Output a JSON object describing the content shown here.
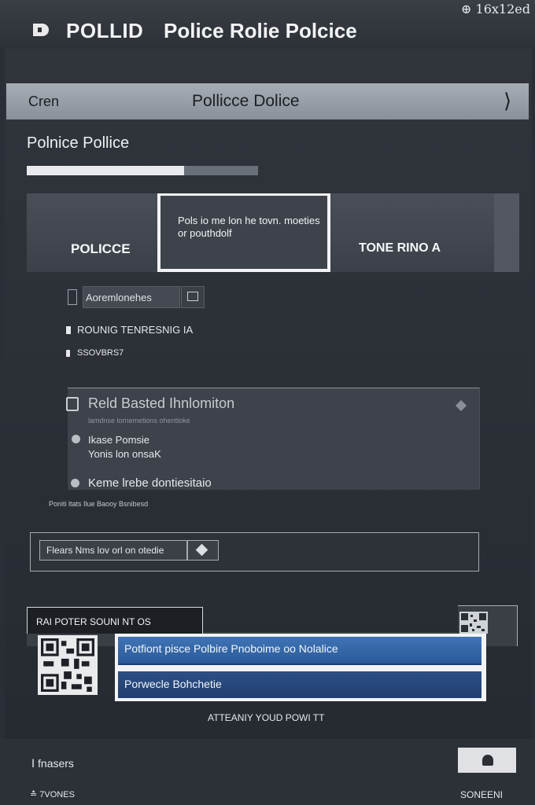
{
  "status_bar": {
    "text": "⊕ 16x12ed"
  },
  "header": {
    "brand": "POLLID",
    "title": "Police Rolie Polcice"
  },
  "navbar": {
    "left": "Cren",
    "center": "Pollicce Dolice",
    "chevron": "⟩"
  },
  "section": {
    "title": "Polnice Pollice",
    "progress": 0.68
  },
  "tabs": {
    "left_label": "POLICCE",
    "popup_text": "Pols io me lon he tovn. moeties or pouthdolf",
    "right_label": "TONE RINO A"
  },
  "dropdown": {
    "value": "Aoremlonehes"
  },
  "list": {
    "item1": "ROUNIG TENRESNIG IA",
    "item2": "SSOVBRS7"
  },
  "card": {
    "title": "Reld Basted Ihnlomiton",
    "subtitle": "lamdnse lornemetions ohentloke",
    "option1": [
      "Ikase Pomsie",
      "Yonis lon onsaK"
    ],
    "option2": "Keme lrebe dontiesitaio",
    "footnote": "Poniti ltats Ilue Baooy Bsnibesd"
  },
  "search": {
    "placeholder": "Flears Nms lov orl on otedie"
  },
  "pass": {
    "tab_label": "RAI POTER SOUNI NT OS",
    "primary_button": "Potfiont pisce Polbire Pnoboime oo Nolalice",
    "secondary_button": "Porwecle Bohchetie",
    "attestation": "ATTEANIY YOUD POWI TT"
  },
  "footer": {
    "left_top": "Ⅰ fnasers",
    "left_bottom": "≛ 7VONES",
    "right_bottom": "SONEENI"
  },
  "colors": {
    "accent_blue": "#3f74b5",
    "navbar": "#9aa0a8",
    "background": "#2a2e36"
  }
}
